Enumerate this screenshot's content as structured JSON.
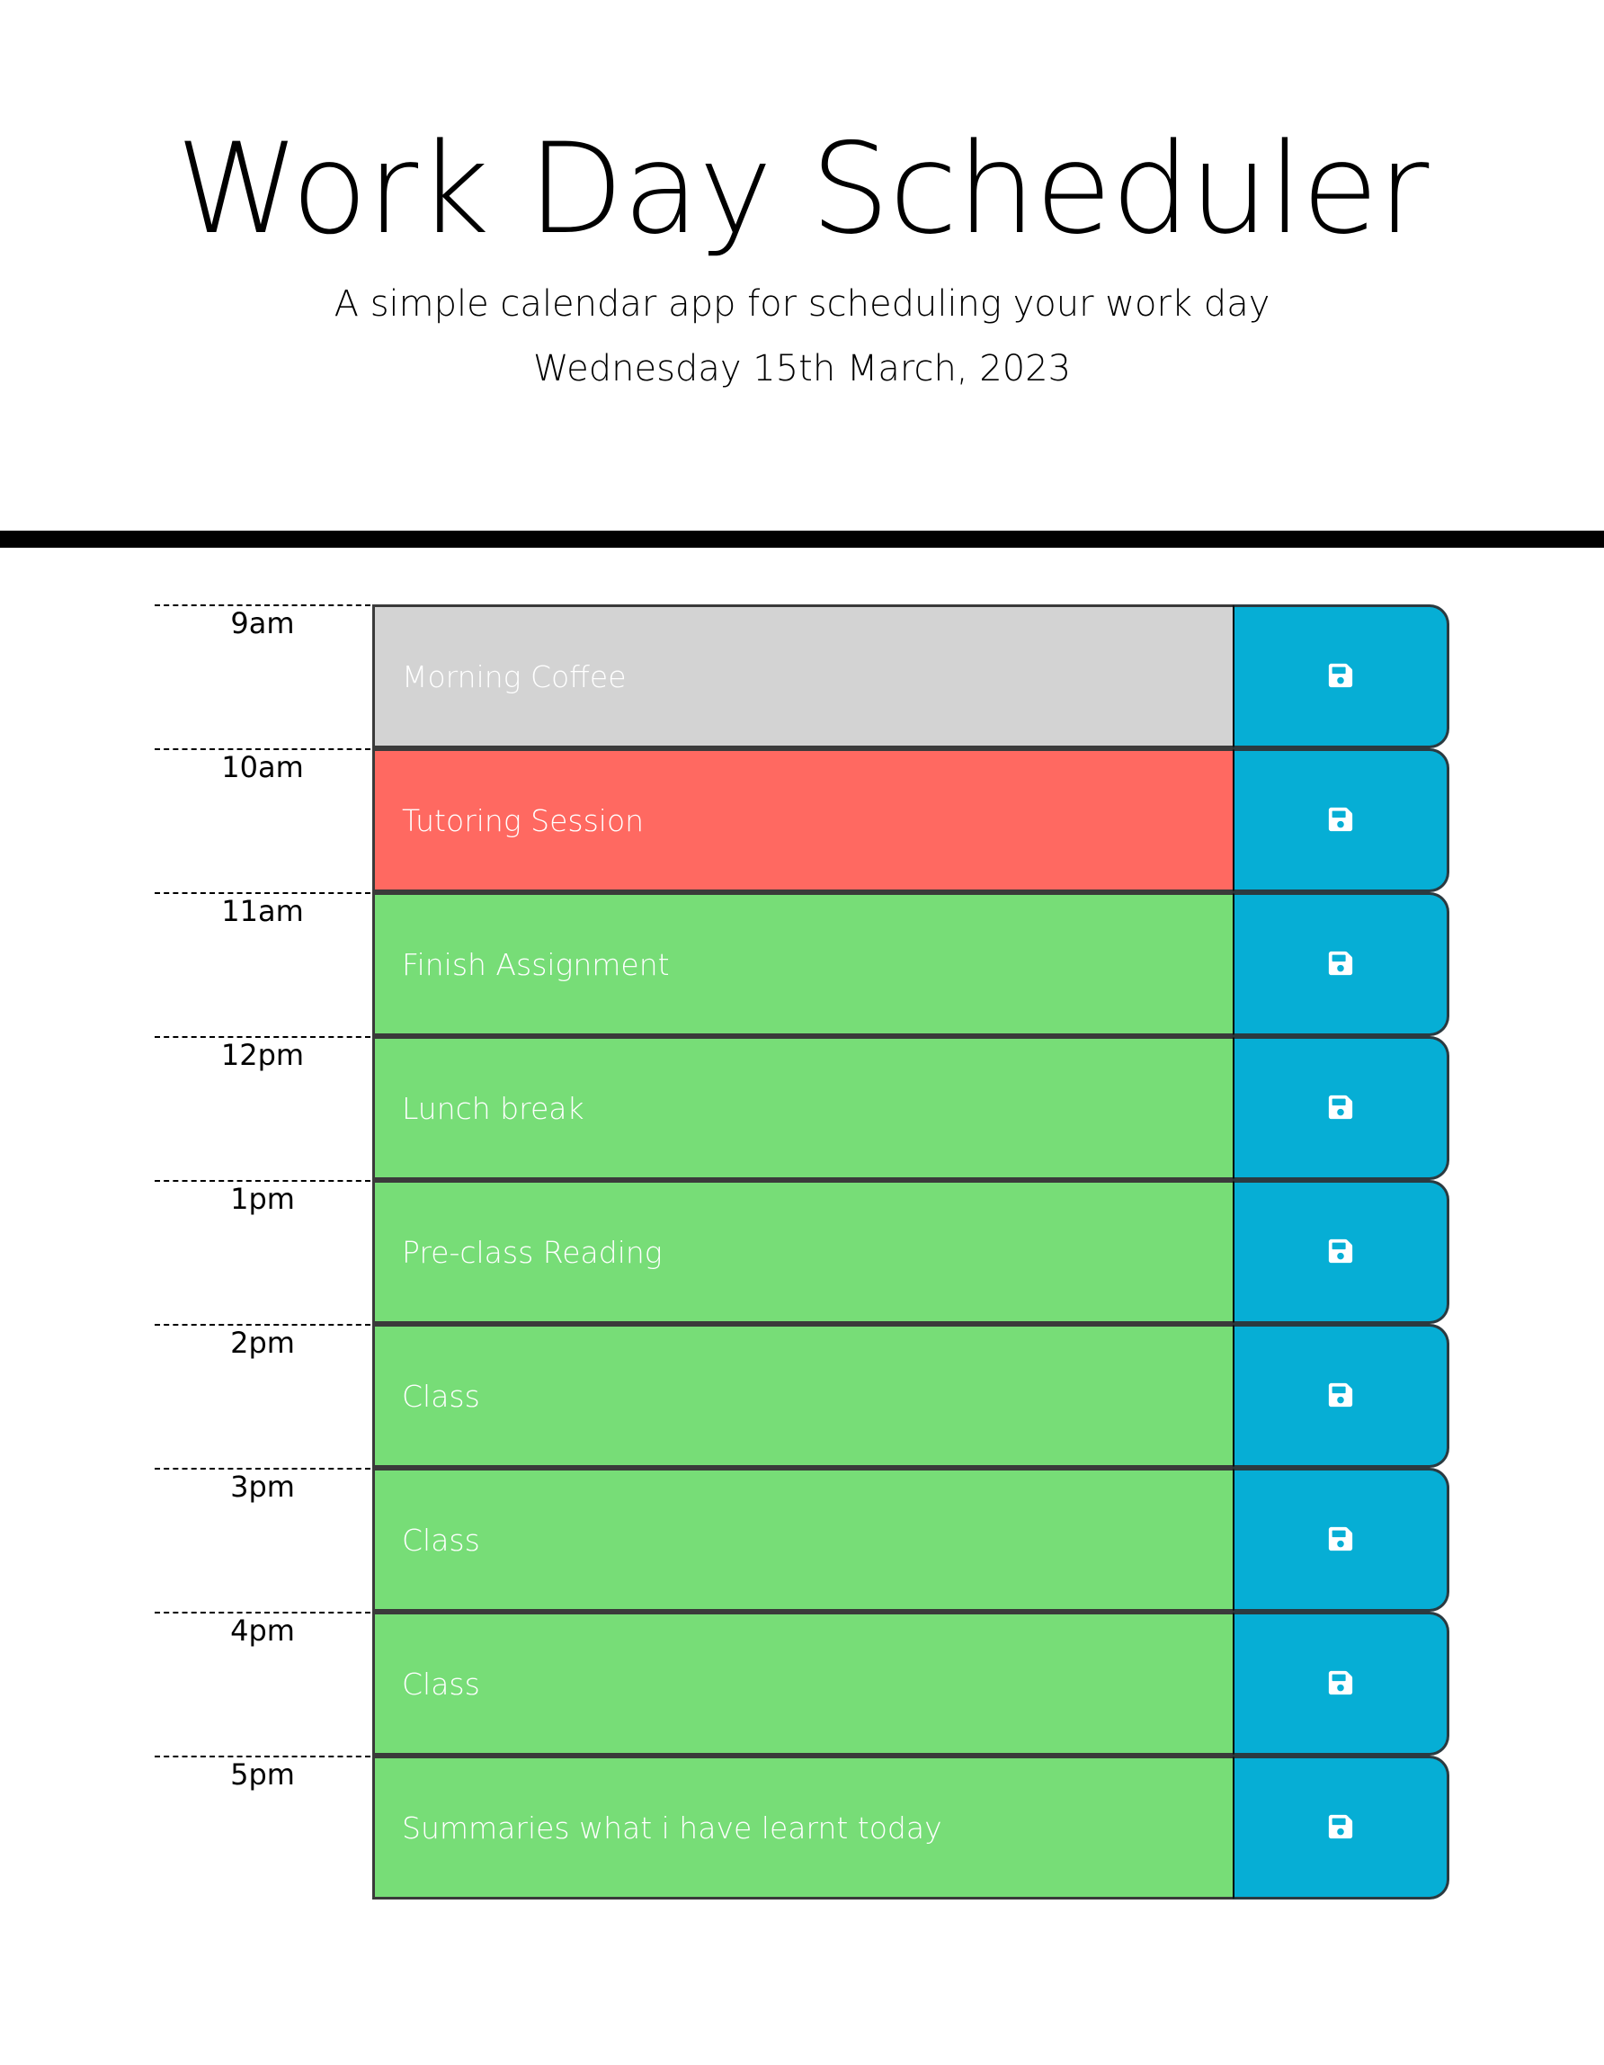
{
  "header": {
    "title": "Work Day Scheduler",
    "subtitle": "A simple calendar app for scheduling your work day",
    "current_day": "Wednesday 15th March, 2023"
  },
  "colors": {
    "past": "#d3d3d3",
    "present": "#ff6961",
    "future": "#77dd77",
    "save_button": "#06aed5"
  },
  "time_blocks": [
    {
      "hour": "9am",
      "text": "Morning Coffee",
      "state": "past",
      "save_icon": "floppy-disk-icon"
    },
    {
      "hour": "10am",
      "text": "Tutoring Session",
      "state": "present",
      "save_icon": "floppy-disk-icon"
    },
    {
      "hour": "11am",
      "text": "Finish Assignment",
      "state": "future",
      "save_icon": "floppy-disk-icon"
    },
    {
      "hour": "12pm",
      "text": "Lunch break",
      "state": "future",
      "save_icon": "floppy-disk-icon"
    },
    {
      "hour": "1pm",
      "text": "Pre-class Reading",
      "state": "future",
      "save_icon": "floppy-disk-icon"
    },
    {
      "hour": "2pm",
      "text": "Class",
      "state": "future",
      "save_icon": "floppy-disk-icon"
    },
    {
      "hour": "3pm",
      "text": "Class",
      "state": "future",
      "save_icon": "floppy-disk-icon"
    },
    {
      "hour": "4pm",
      "text": "Class",
      "state": "future",
      "save_icon": "floppy-disk-icon"
    },
    {
      "hour": "5pm",
      "text": "Summaries what i have learnt today",
      "state": "future",
      "save_icon": "floppy-disk-icon"
    }
  ]
}
